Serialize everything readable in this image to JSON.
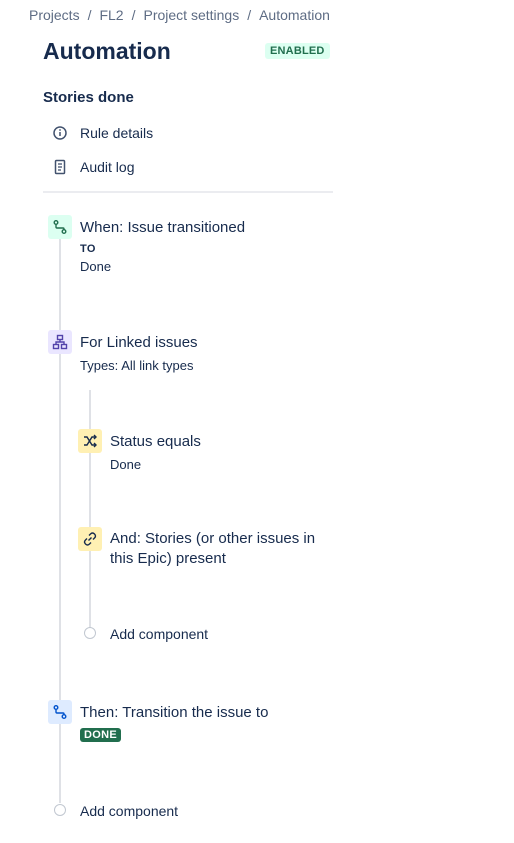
{
  "breadcrumbs": {
    "items": [
      "Projects",
      "FL2",
      "Project settings",
      "Automation"
    ],
    "separator": "/"
  },
  "page": {
    "title": "Automation",
    "status_badge": "ENABLED"
  },
  "rule": {
    "name": "Stories done",
    "menu": [
      {
        "label": "Rule details",
        "icon": "info-icon"
      },
      {
        "label": "Audit log",
        "icon": "document-icon"
      }
    ]
  },
  "components": {
    "trigger": {
      "title": "When: Issue transitioned",
      "to_label": "TO",
      "to_value": "Done",
      "icon": "transition-icon",
      "color": "#dcfff1"
    },
    "branch": {
      "title": "For Linked issues",
      "subtitle": "Types: All link types",
      "icon": "hierarchy-icon",
      "color": "#eae6ff",
      "children": {
        "condition1": {
          "title": "Status equals",
          "subtitle": "Done",
          "icon": "shuffle-icon",
          "color": "#fff0b3"
        },
        "condition2": {
          "title": "And: Stories (or other issues in this Epic) present",
          "icon": "link-icon",
          "color": "#fff0b3"
        },
        "add_label": "Add component"
      }
    },
    "action": {
      "title": "Then: Transition the issue to",
      "status_lozenge": "DONE",
      "icon": "transition-icon",
      "color": "#deebff"
    },
    "add_label": "Add component"
  }
}
